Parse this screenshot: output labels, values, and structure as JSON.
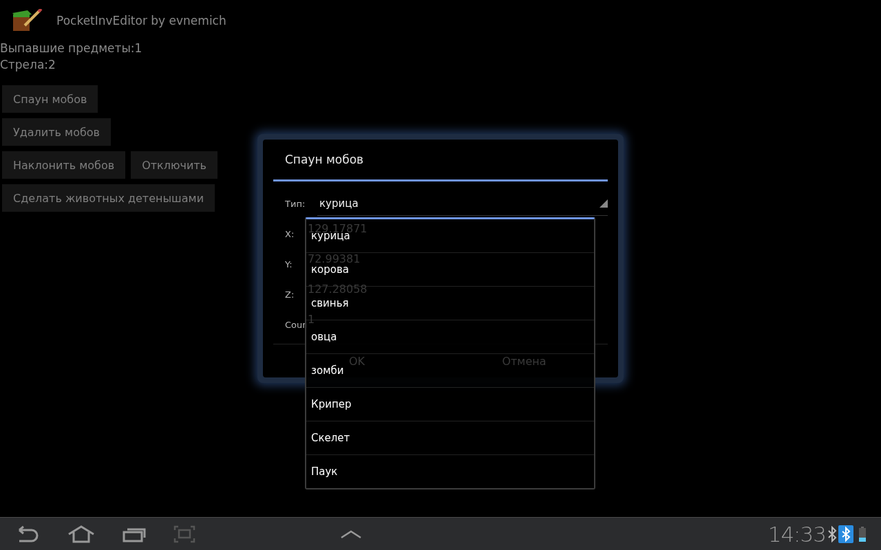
{
  "app": {
    "title": "PocketInvEditor by evnemich"
  },
  "info_lines": [
    "Выпавшие предметы:1",
    "Стрела:2"
  ],
  "button_rows": [
    [
      "Спаун мобов"
    ],
    [
      "Удалить мобов"
    ],
    [
      "Наклонить мобов",
      "Отключить"
    ],
    [
      "Сделать животных детенышами"
    ]
  ],
  "dialog": {
    "title": "Спаун мобов",
    "type_label": "Тип:",
    "type_value": "курица",
    "fields": [
      {
        "label": "X:",
        "value": "129.17871"
      },
      {
        "label": "Y:",
        "value": "72.99381"
      },
      {
        "label": "Z:",
        "value": "127.28058"
      },
      {
        "label": "Coun",
        "value": "1"
      }
    ],
    "buttons": [
      "OK",
      "Отмена"
    ]
  },
  "dropdown": {
    "items": [
      {
        "label": "курица",
        "selected": false
      },
      {
        "label": "корова",
        "selected": false
      },
      {
        "label": "свинья",
        "selected": false
      },
      {
        "label": "овца",
        "selected": false
      },
      {
        "label": "зомби",
        "selected": false
      },
      {
        "label": "Крипер",
        "selected": false
      },
      {
        "label": "Скелет",
        "selected": false
      },
      {
        "label": "Паук",
        "selected": false
      }
    ]
  },
  "system_bar": {
    "time": "14:33"
  }
}
